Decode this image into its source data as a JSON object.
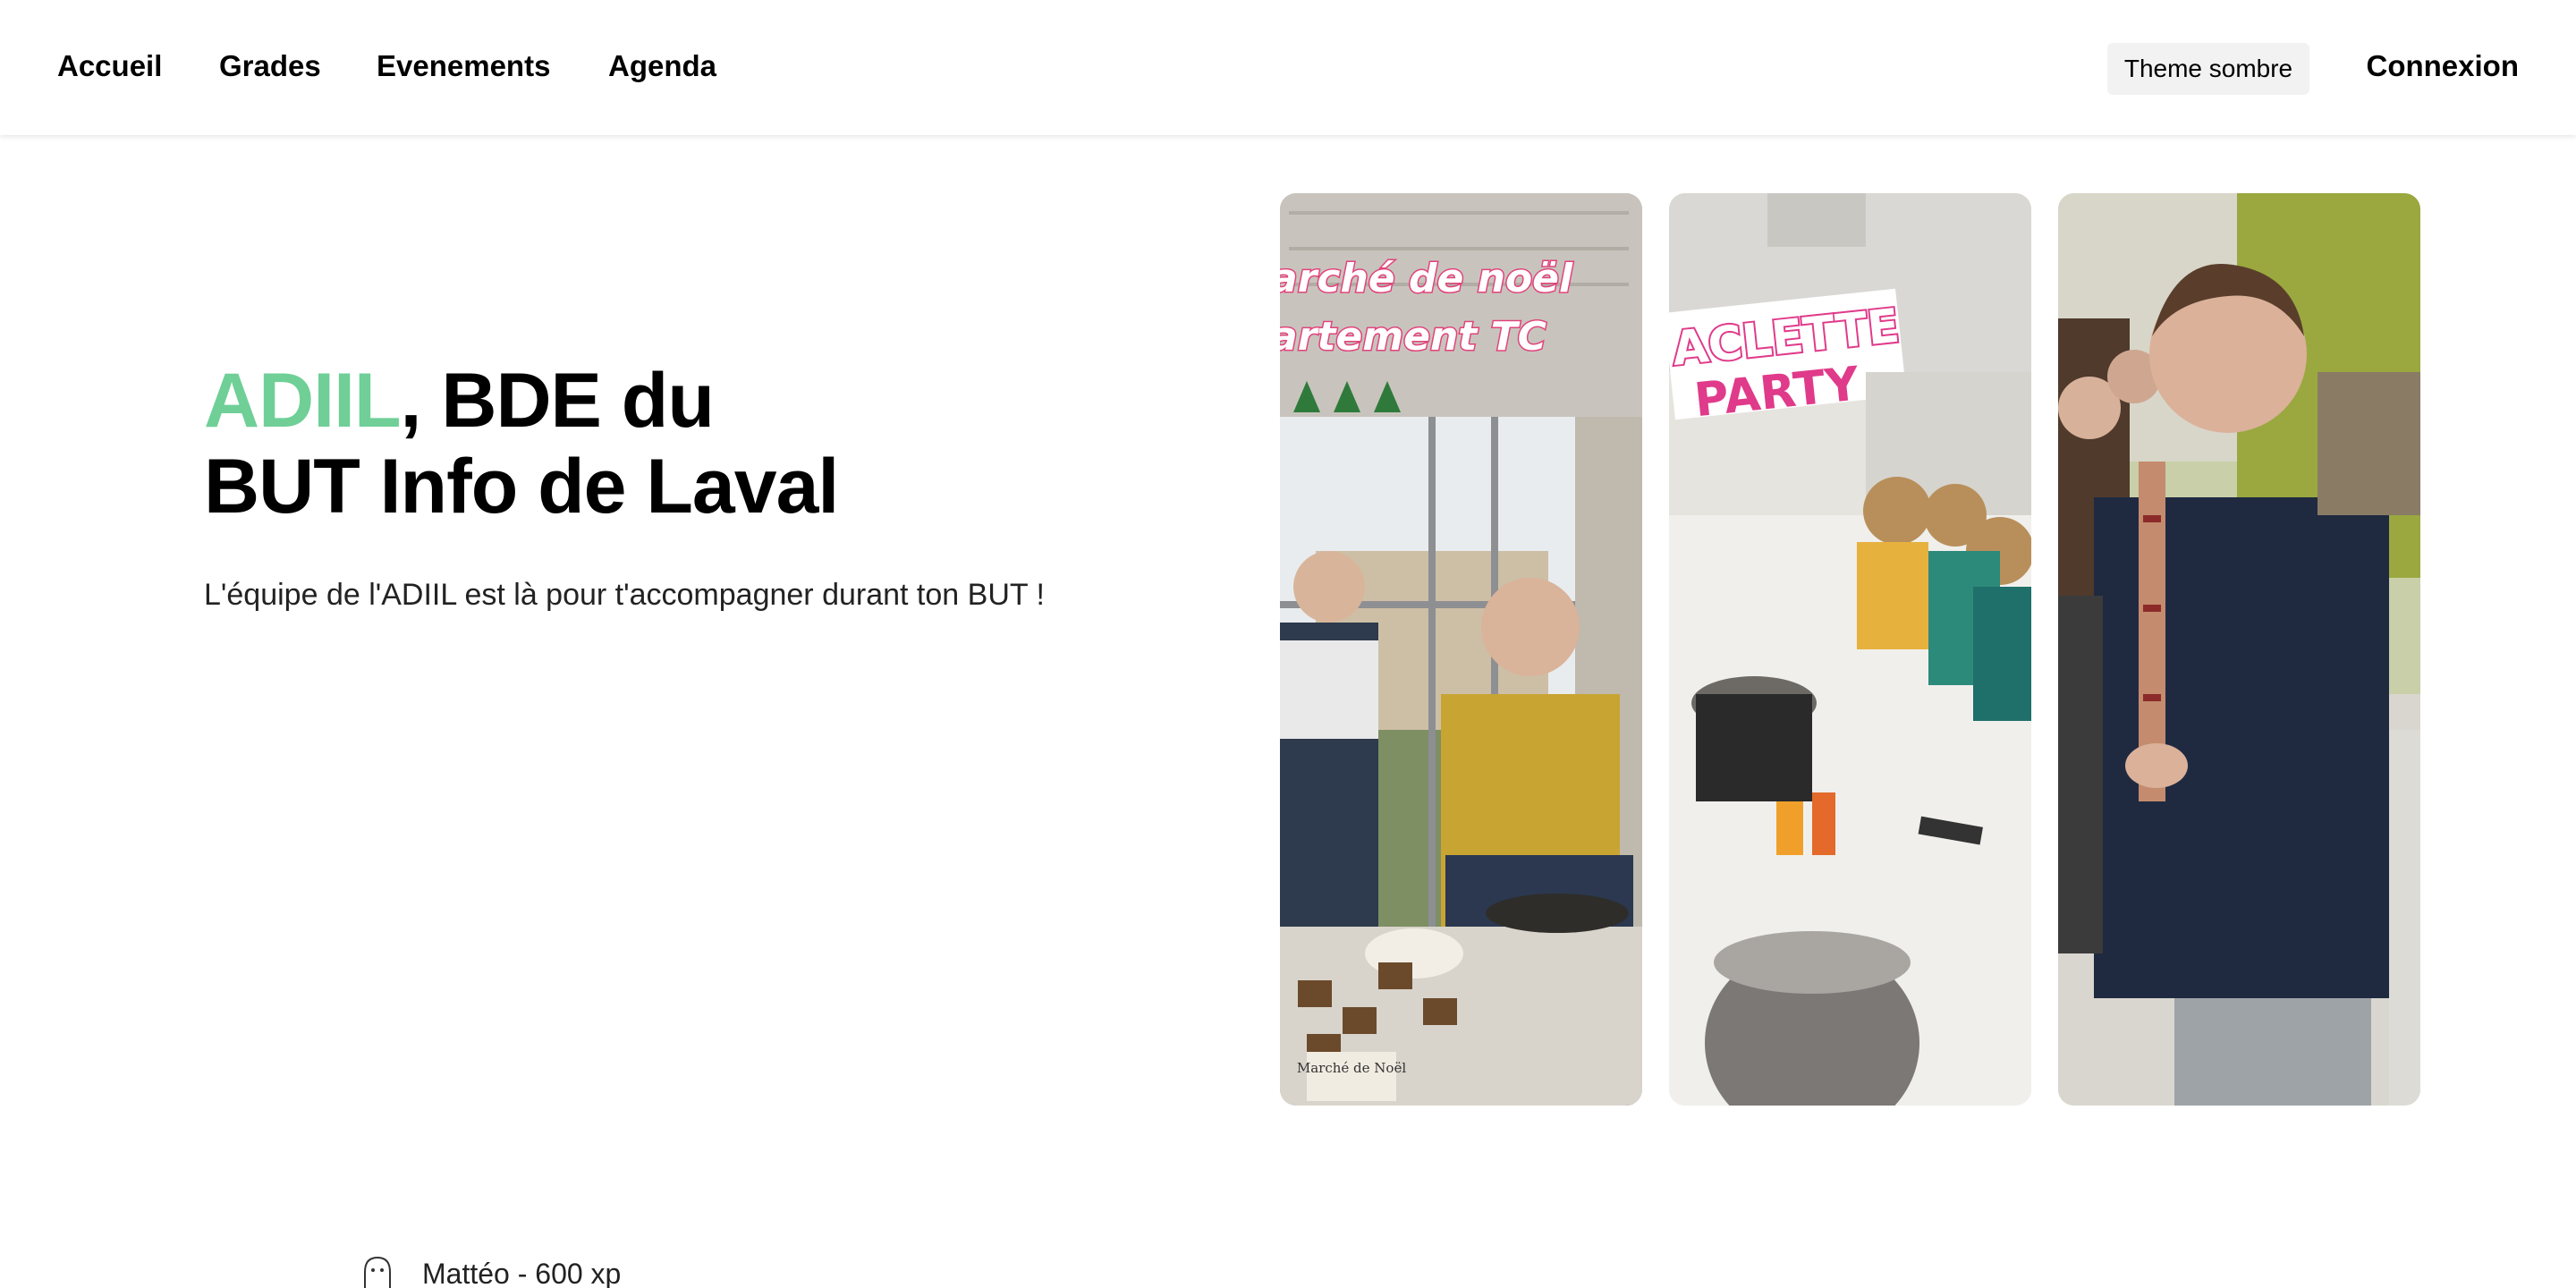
{
  "nav": {
    "items": [
      {
        "label": "Accueil"
      },
      {
        "label": "Grades"
      },
      {
        "label": "Evenements"
      },
      {
        "label": "Agenda"
      }
    ],
    "theme_button": "Theme sombre",
    "login": "Connexion"
  },
  "hero": {
    "title_accent": "ADIIL",
    "title_rest_line1": ", BDE du",
    "title_line2": "BUT Info de Laval",
    "subtitle": "L'équipe de l'ADIIL est là pour t'accompagner durant ton BUT !",
    "accent_color": "#6fcf97"
  },
  "photos": [
    {
      "overlay_line1": "arché de noël",
      "overlay_line2": "artement TC",
      "sign": "Marché de Noël"
    },
    {
      "overlay_line1": "ACLETTE",
      "overlay_line2": "PARTY"
    },
    {}
  ],
  "member": {
    "text": "Mattéo - 600 xp",
    "icon": "ghost-icon"
  }
}
